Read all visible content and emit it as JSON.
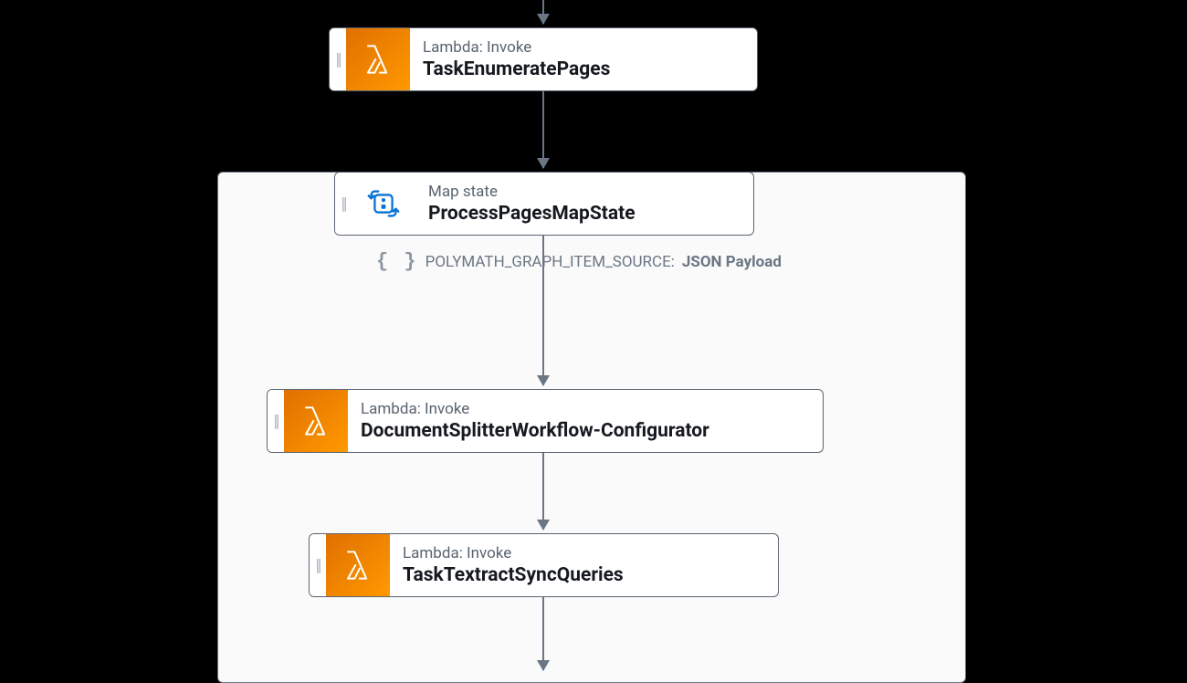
{
  "nodes": {
    "enumerate": {
      "type": "Lambda: Invoke",
      "title": "TaskEnumeratePages"
    },
    "mapstate": {
      "type": "Map state",
      "title": "ProcessPagesMapState"
    },
    "config": {
      "type": "Lambda: Invoke",
      "title": "DocumentSplitterWorkflow-Configurator"
    },
    "textract": {
      "type": "Lambda: Invoke",
      "title": "TaskTextractSyncQueries"
    }
  },
  "payload": {
    "key": "POLYMATH_GRAPH_ITEM_SOURCE:",
    "val": "JSON Payload"
  },
  "grip_glyph": "||"
}
